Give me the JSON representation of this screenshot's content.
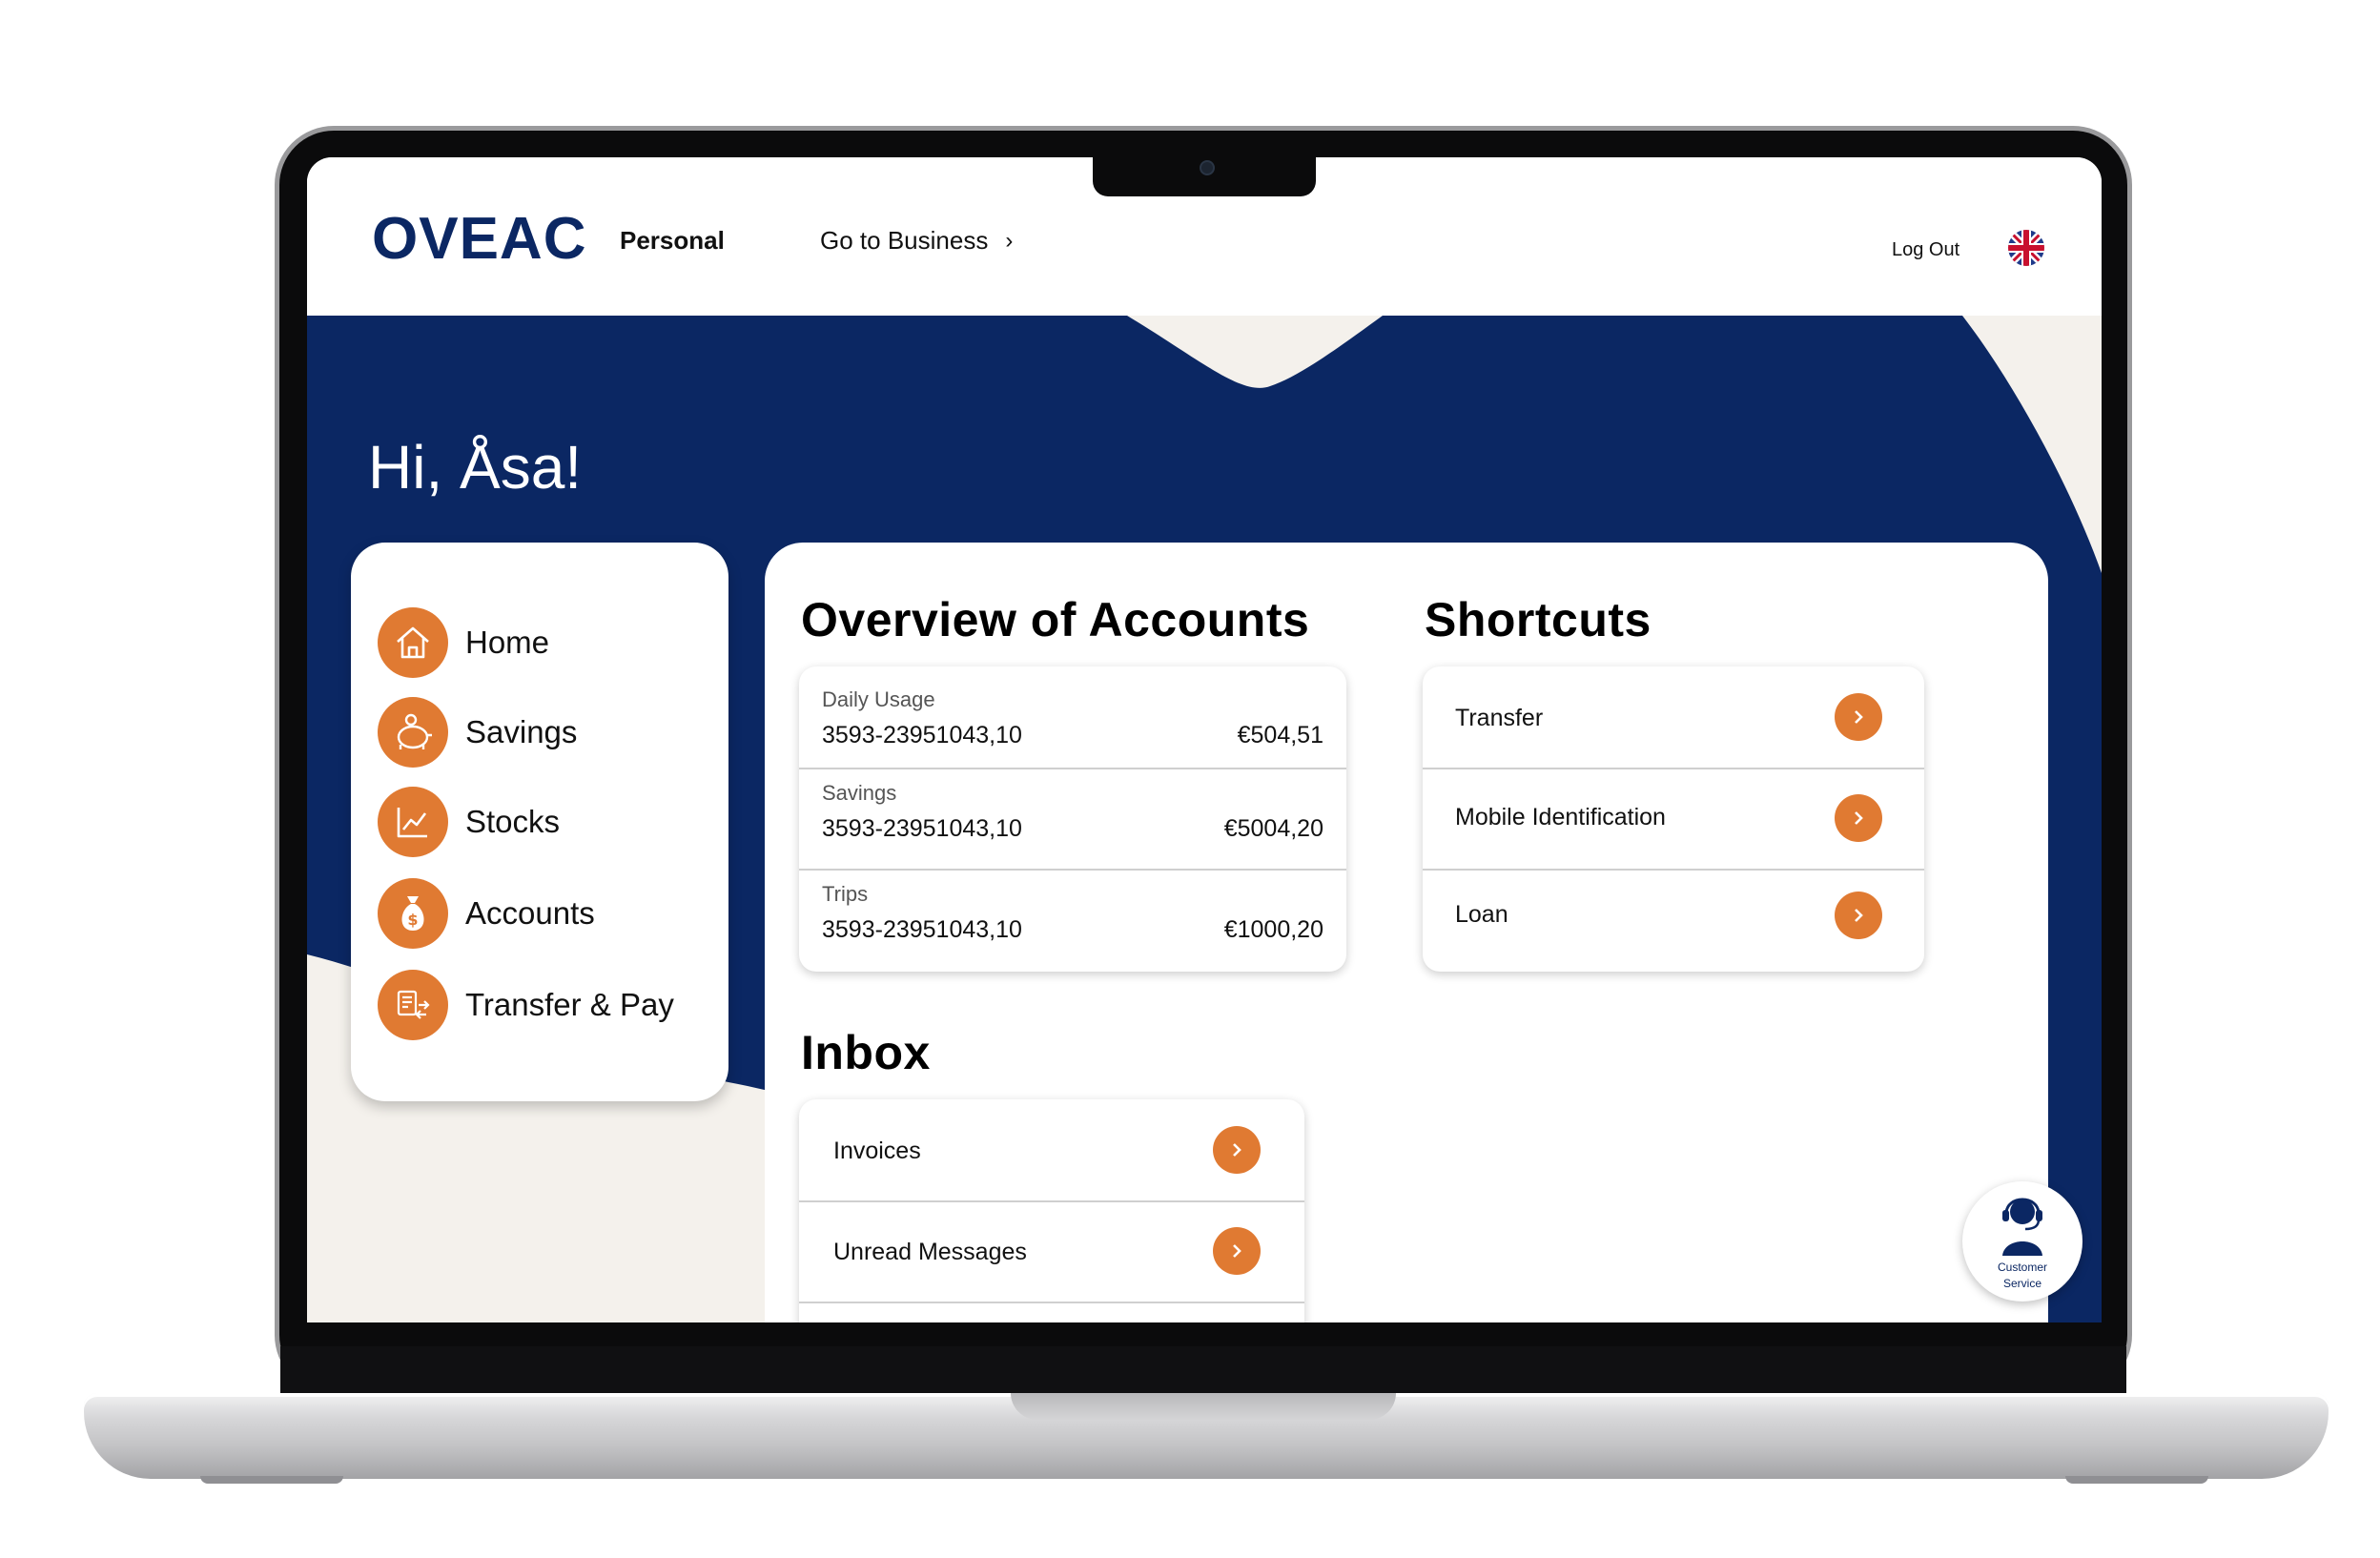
{
  "header": {
    "brand": "OVEAC",
    "nav_personal": "Personal",
    "nav_business": "Go to Business",
    "logout": "Log Out",
    "language_icon": "uk-flag-icon"
  },
  "greeting": "Hi, Åsa!",
  "sidebar": {
    "items": [
      {
        "label": "Home",
        "icon": "home-icon"
      },
      {
        "label": "Savings",
        "icon": "piggy-bank-icon"
      },
      {
        "label": "Stocks",
        "icon": "chart-line-icon"
      },
      {
        "label": "Accounts",
        "icon": "money-bag-icon"
      },
      {
        "label": "Transfer & Pay",
        "icon": "transfer-pay-icon"
      }
    ]
  },
  "overview": {
    "title": "Overview of Accounts",
    "accounts": [
      {
        "name": "Daily Usage",
        "number": "3593-23951043,10",
        "balance": "€504,51"
      },
      {
        "name": "Savings",
        "number": "3593-23951043,10",
        "balance": "€5004,20"
      },
      {
        "name": "Trips",
        "number": "3593-23951043,10",
        "balance": "€1000,20"
      }
    ]
  },
  "shortcuts": {
    "title": "Shortcuts",
    "items": [
      {
        "label": "Transfer"
      },
      {
        "label": "Mobile Identification"
      },
      {
        "label": "Loan"
      }
    ]
  },
  "inbox": {
    "title": "Inbox",
    "items": [
      {
        "label": "Invoices"
      },
      {
        "label": "Unread Messages"
      }
    ]
  },
  "support": {
    "line1": "Customer",
    "line2": "Service"
  },
  "colors": {
    "navy": "#0b2763",
    "accent_orange": "#e07a32",
    "cream": "#f4f1ec"
  }
}
